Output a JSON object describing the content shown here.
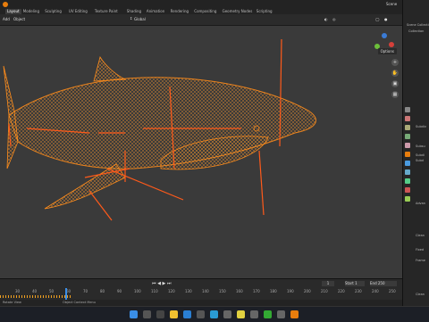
{
  "topbar": {
    "workspaces": [
      "Layout",
      "Modeling",
      "Sculpting",
      "UV Editing",
      "Texture Paint",
      "Shading",
      "Animation",
      "Rendering",
      "Compositing",
      "Geometry Nodes",
      "Scripting"
    ],
    "active_workspace": "Layout",
    "scene_label": "Scene"
  },
  "header": {
    "mode": "Add",
    "object_menu": "Object",
    "orientation": "Global",
    "options": "Options"
  },
  "timeline": {
    "ticks": [
      "30",
      "40",
      "50",
      "60",
      "70",
      "80",
      "90",
      "100",
      "110",
      "120",
      "130",
      "140",
      "150",
      "160",
      "170",
      "180",
      "190",
      "200",
      "210",
      "220",
      "230",
      "240",
      "250"
    ],
    "current_frame": "1",
    "start_label": "Start",
    "start_value": "1",
    "end_label": "End",
    "end_value": "250"
  },
  "statusbar": {
    "left": "Rotate View",
    "right": "Object Context Menu"
  },
  "right_panel": {
    "outliner_items": [
      "Scene Collection",
      "Collection"
    ],
    "labels": [
      "Subdiv",
      "Subsu",
      "Subdi",
      "Subd",
      "Advan",
      "Clean",
      "Fixed",
      "Frame",
      "Clean"
    ]
  },
  "colors": {
    "wireframe": "#ff8c1a",
    "viewport_bg": "#3a3a3a",
    "accent": "#f0a020"
  }
}
